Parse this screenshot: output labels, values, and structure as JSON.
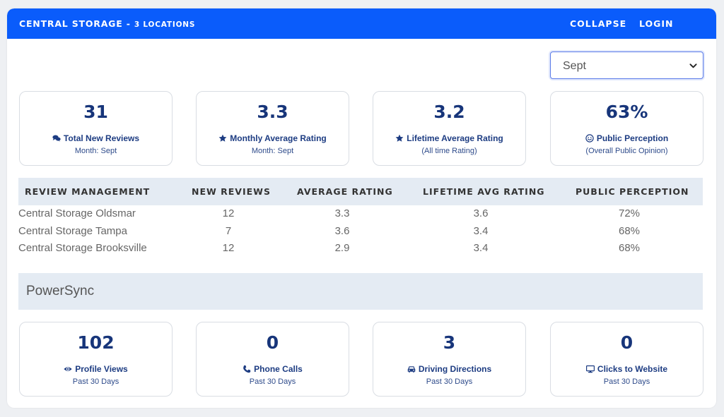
{
  "header": {
    "brand": "CENTRAL STORAGE",
    "separator": " - ",
    "brand_sub": "3 LOCATIONS",
    "collapse_label": "COLLAPSE",
    "login_label": "LOGIN",
    "bg_color": "#0a5cfb"
  },
  "month_select": {
    "selected": "Sept"
  },
  "summary_cards": [
    {
      "value": "31",
      "icon": "comments-icon",
      "label": "Total New Reviews",
      "sub": "Month: Sept"
    },
    {
      "value": "3.3",
      "icon": "star-icon",
      "label": "Monthly Average Rating",
      "sub": "Month: Sept"
    },
    {
      "value": "3.2",
      "icon": "star-icon",
      "label": "Lifetime Average Rating",
      "sub": "(All time Rating)"
    },
    {
      "value": "63%",
      "icon": "smile-icon",
      "label": "Public Perception",
      "sub": "(Overall Public Opinion)"
    }
  ],
  "table": {
    "columns": [
      "REVIEW MANAGEMENT",
      "NEW REVIEWS",
      "AVERAGE RATING",
      "LIFETIME AVG RATING",
      "PUBLIC PERCEPTION"
    ],
    "rows": [
      [
        "Central Storage Oldsmar",
        "12",
        "3.3",
        "3.6",
        "72%"
      ],
      [
        "Central Storage Tampa",
        "7",
        "3.6",
        "3.4",
        "68%"
      ],
      [
        "Central Storage Brooksville",
        "12",
        "2.9",
        "3.4",
        "68%"
      ]
    ]
  },
  "powersync": {
    "title": "PowerSync",
    "cards": [
      {
        "value": "102",
        "icon": "eye-icon",
        "label": "Profile Views",
        "sub": "Past 30 Days"
      },
      {
        "value": "0",
        "icon": "phone-icon",
        "label": "Phone Calls",
        "sub": "Past 30 Days"
      },
      {
        "value": "3",
        "icon": "car-icon",
        "label": "Driving Directions",
        "sub": "Past 30 Days"
      },
      {
        "value": "0",
        "icon": "monitor-icon",
        "label": "Clicks to Website",
        "sub": "Past 30 Days"
      }
    ]
  }
}
